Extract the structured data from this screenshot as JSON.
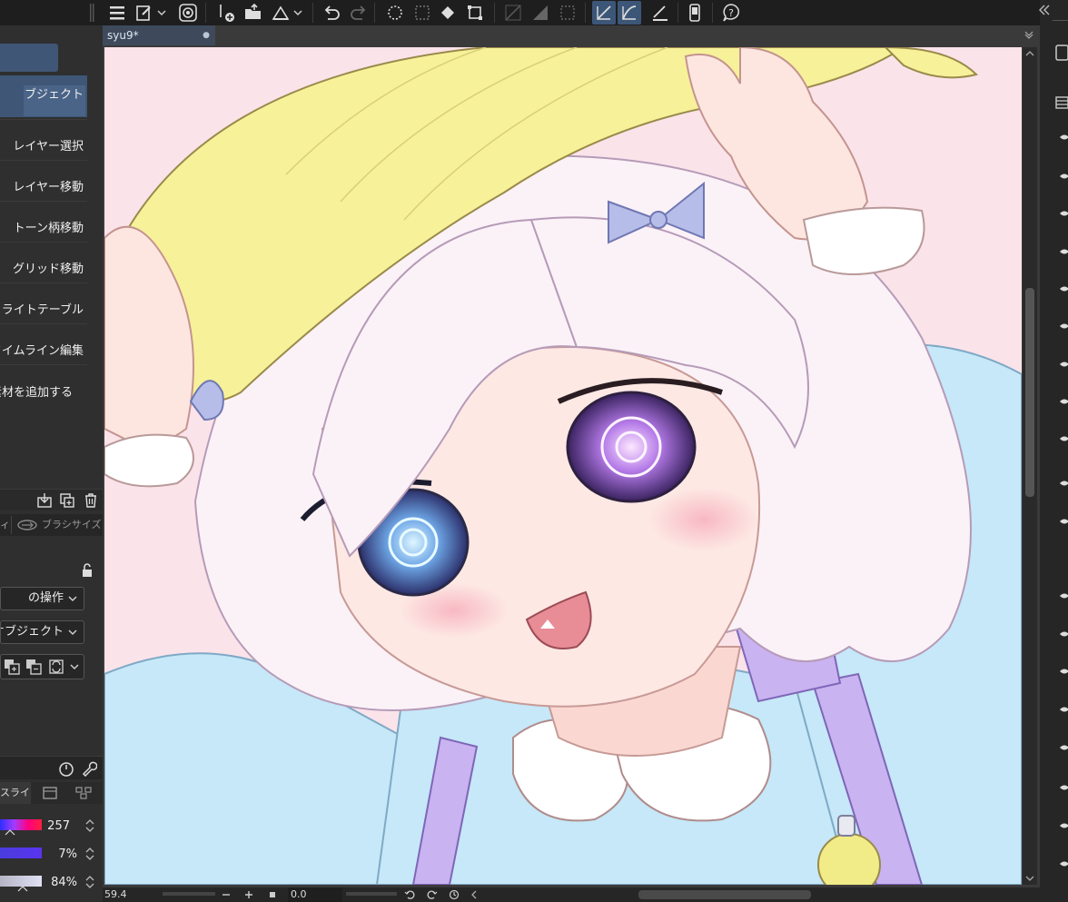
{
  "document": {
    "tab_title": "syu9*",
    "modified_dot": "●"
  },
  "left_panel": {
    "subtools": [
      {
        "label": "オブジェクト",
        "selected": true
      },
      {
        "label": "レイヤー選択"
      },
      {
        "label": "レイヤー移動"
      },
      {
        "label": "トーン柄移動"
      },
      {
        "label": "グリッド移動"
      },
      {
        "label": "ライトテーブル"
      },
      {
        "label": "タイムライン編集"
      },
      {
        "label": "素材を追加する"
      }
    ],
    "tool_property_tabs": [
      "ィ",
      "ブラシサイズ"
    ],
    "operation_dropdown": "の操作",
    "target_dropdown": "オブジェクト",
    "color_tab": "スライ",
    "sliders": [
      {
        "value": "257",
        "color": "hue"
      },
      {
        "value": "7%",
        "color": "saturation"
      },
      {
        "value": "84%",
        "color": "value"
      }
    ]
  },
  "status_bar": {
    "zoom": "59.4",
    "angle": "0.0"
  },
  "colors": {
    "accent": "#3c5677",
    "hat": "#f7f19a",
    "sweater": "#c9eaf9",
    "backpack": "#c8b3f0"
  }
}
